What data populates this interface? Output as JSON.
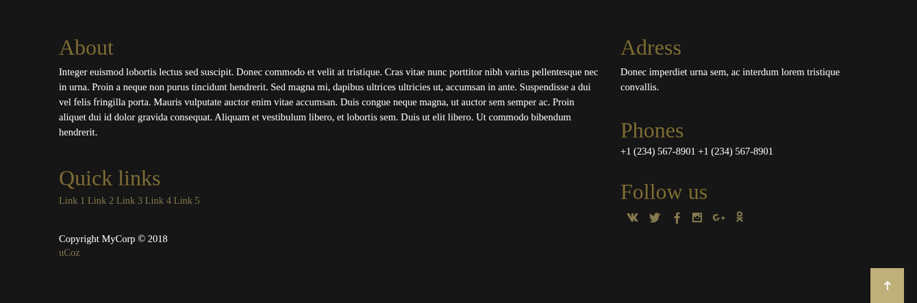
{
  "about": {
    "title": "About",
    "text": "Integer euismod lobortis lectus sed suscipit. Donec commodo et velit at tristique. Cras vitae nunc porttitor nibh varius pellentesque nec in urna. Proin a neque non purus tincidunt hendrerit. Sed magna mi, dapibus ultrices ultricies ut, accumsan in ante. Suspendisse a dui vel felis fringilla porta. Mauris vulputate auctor enim vitae accumsan. Duis congue neque magna, ut auctor sem semper ac. Proin aliquet dui id dolor gravida consequat. Aliquam et vestibulum libero, et lobortis sem. Duis ut elit libero. Ut commodo bibendum hendrerit."
  },
  "quick_links": {
    "title": "Quick links",
    "links": [
      "Link 1",
      "Link 2",
      "Link 3",
      "Link 4",
      "Link 5"
    ]
  },
  "copyright": "Copyright MyCorp © 2018",
  "powered_by": "uCoz",
  "address": {
    "title": "Adress",
    "text": "Donec imperdiet urna sem, ac interdum lorem tristique convallis."
  },
  "phones": {
    "title": "Phones",
    "numbers": [
      "+1 (234) 567-8901",
      "+1 (234) 567-8901"
    ]
  },
  "follow": {
    "title": "Follow us",
    "icons": [
      {
        "kind": "vk"
      },
      {
        "kind": "twitter"
      },
      {
        "kind": "facebook"
      },
      {
        "kind": "instagram"
      },
      {
        "kind": "gplus"
      },
      {
        "kind": "ok"
      }
    ]
  },
  "scroll_top": {
    "kind": "arrow-up"
  }
}
